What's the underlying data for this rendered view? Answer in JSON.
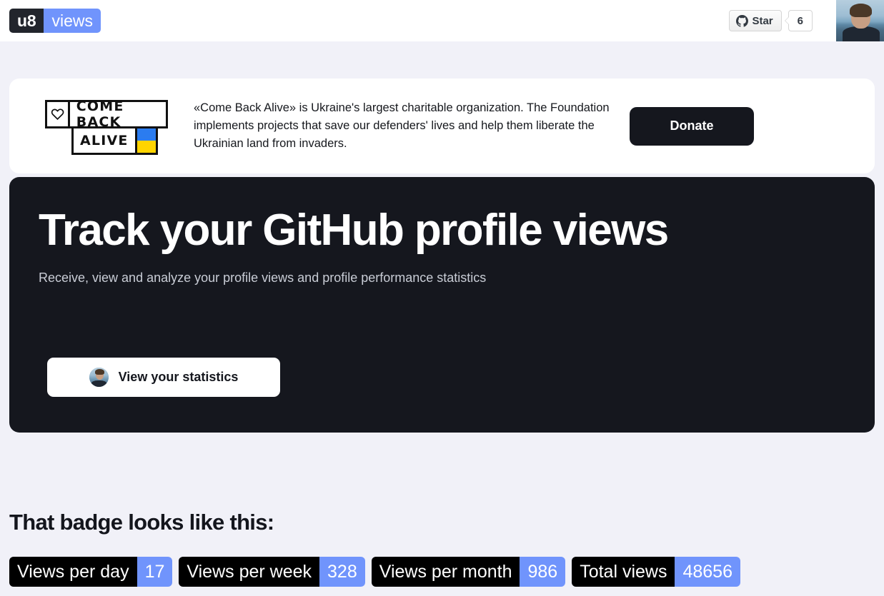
{
  "header": {
    "logo_left": "u8",
    "logo_right": "views",
    "github_star_label": "Star",
    "github_star_count": "6",
    "github_icon": "github-octocat-icon",
    "avatar_alt": "user-avatar"
  },
  "banner": {
    "logo_line1": "COME BACK",
    "logo_line2": "ALIVE",
    "logo_heart_icon": "heart-icon",
    "text": "«Come Back Alive» is Ukraine's largest charitable organization. The Foundation implements projects that save our defenders' lives and help them liberate the Ukrainian land from invaders.",
    "donate_label": "Donate"
  },
  "hero": {
    "title": "Track your GitHub profile views",
    "subtitle": "Receive, view and analyze your profile views and profile performance statistics",
    "cta_label": "View your statistics",
    "cta_avatar": "user-avatar"
  },
  "badges_section": {
    "heading": "That badge looks like this:",
    "badges": [
      {
        "label": "Views per day",
        "value": "17"
      },
      {
        "label": "Views per week",
        "value": "328"
      },
      {
        "label": "Views per month",
        "value": "986"
      },
      {
        "label": "Total views",
        "value": "48656"
      }
    ]
  },
  "colors": {
    "accent_blue": "#7094fc",
    "dark": "#15171e",
    "page_bg": "#f1f1f8",
    "badge_label_bg": "#000000"
  }
}
